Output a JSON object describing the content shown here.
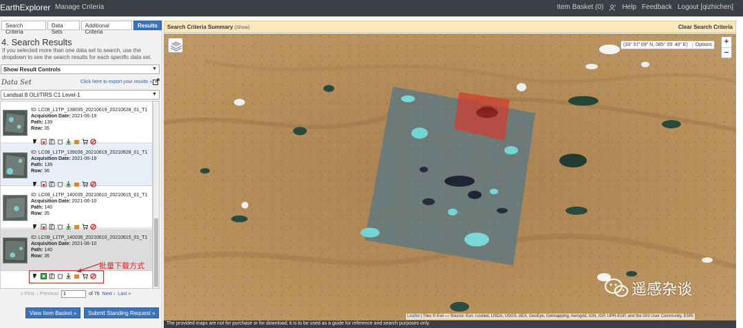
{
  "topbar": {
    "brand": "EarthExplorer",
    "manage": "Manage Criteria",
    "item_basket": "Item Basket (0)",
    "help": "Help",
    "feedback": "Feedback",
    "logout": "Logout [qizhichen]"
  },
  "tabs": [
    "Search Criteria",
    "Data Sets",
    "Additional Criteria",
    "Results"
  ],
  "results_panel": {
    "title": "4. Search Results",
    "description": "If you selected more than one data set to search, use the dropdown to see the search results for each specific data set.",
    "controls_select": "Show Result Controls",
    "dataset_label": "Data Set",
    "export_link": "Click here to export your results »",
    "dataset_select": "Landsat 8 OLI/TIRS C1 Level-1"
  },
  "results": [
    {
      "id": "ID: LC08_L1TP_139035_20210619_20210628_01_T1",
      "date_label": "Acquisition Date:",
      "date": "2021-06-19",
      "path_label": "Path:",
      "path": "139",
      "row_label": "Row:",
      "row": "35"
    },
    {
      "id": "ID: LC08_L1TP_139036_20210619_20210628_01_T1",
      "date_label": "Acquisition Date:",
      "date": "2021-06-19",
      "path_label": "Path:",
      "path": "139",
      "row_label": "Row:",
      "row": "36"
    },
    {
      "id": "ID: LC08_L1TP_140035_20210610_20210615_01_T1",
      "date_label": "Acquisition Date:",
      "date": "2021-06-10",
      "path_label": "Path:",
      "path": "140",
      "row_label": "Row:",
      "row": "35"
    },
    {
      "id": "ID: LC08_L1TP_140036_20210610_20210615_01_T1",
      "date_label": "Acquisition Date:",
      "date": "2021-06-10",
      "path_label": "Path:",
      "path": "140",
      "row_label": "Row:",
      "row": "36"
    }
  ],
  "callout": "批量下载方式",
  "pager": {
    "first": "« First",
    "previous": "‹ Previous",
    "page": "1",
    "of": "of 76",
    "next": "Next ›",
    "last": "Last »"
  },
  "buttons": {
    "view_basket": "View Item Basket »",
    "submit_standing": "Submit Standing Request »"
  },
  "criteria_bar": {
    "title": "Search Criteria Summary",
    "show": "(Show)",
    "clear": "Clear Search Criteria"
  },
  "map": {
    "coords": "(33° 57' 09\" N, 085° 05' 40\" E)",
    "options": "Options",
    "zoom_in": "+",
    "zoom_out": "−",
    "attribution_link": "Leaflet",
    "attribution": " | Tiles © Esri — Source: Esri, i-cubed, USDA, USGS, AEX, GeoEye, Getmapping, Aerogrid, IGN, IGP, UPR-EGP, and the GIS User Community, ESRI",
    "disclaimer": "The provided maps are not for purchase or for download; it is to be used as a guide for reference and search purposes only."
  },
  "watermark": "遥感杂谈",
  "colors": {
    "nav": "#3b3e44",
    "accent": "#3b73b9",
    "criteria_bar": "#fbe7bd",
    "highlight": "#e0242c",
    "map_terrain": "#b08a55"
  }
}
